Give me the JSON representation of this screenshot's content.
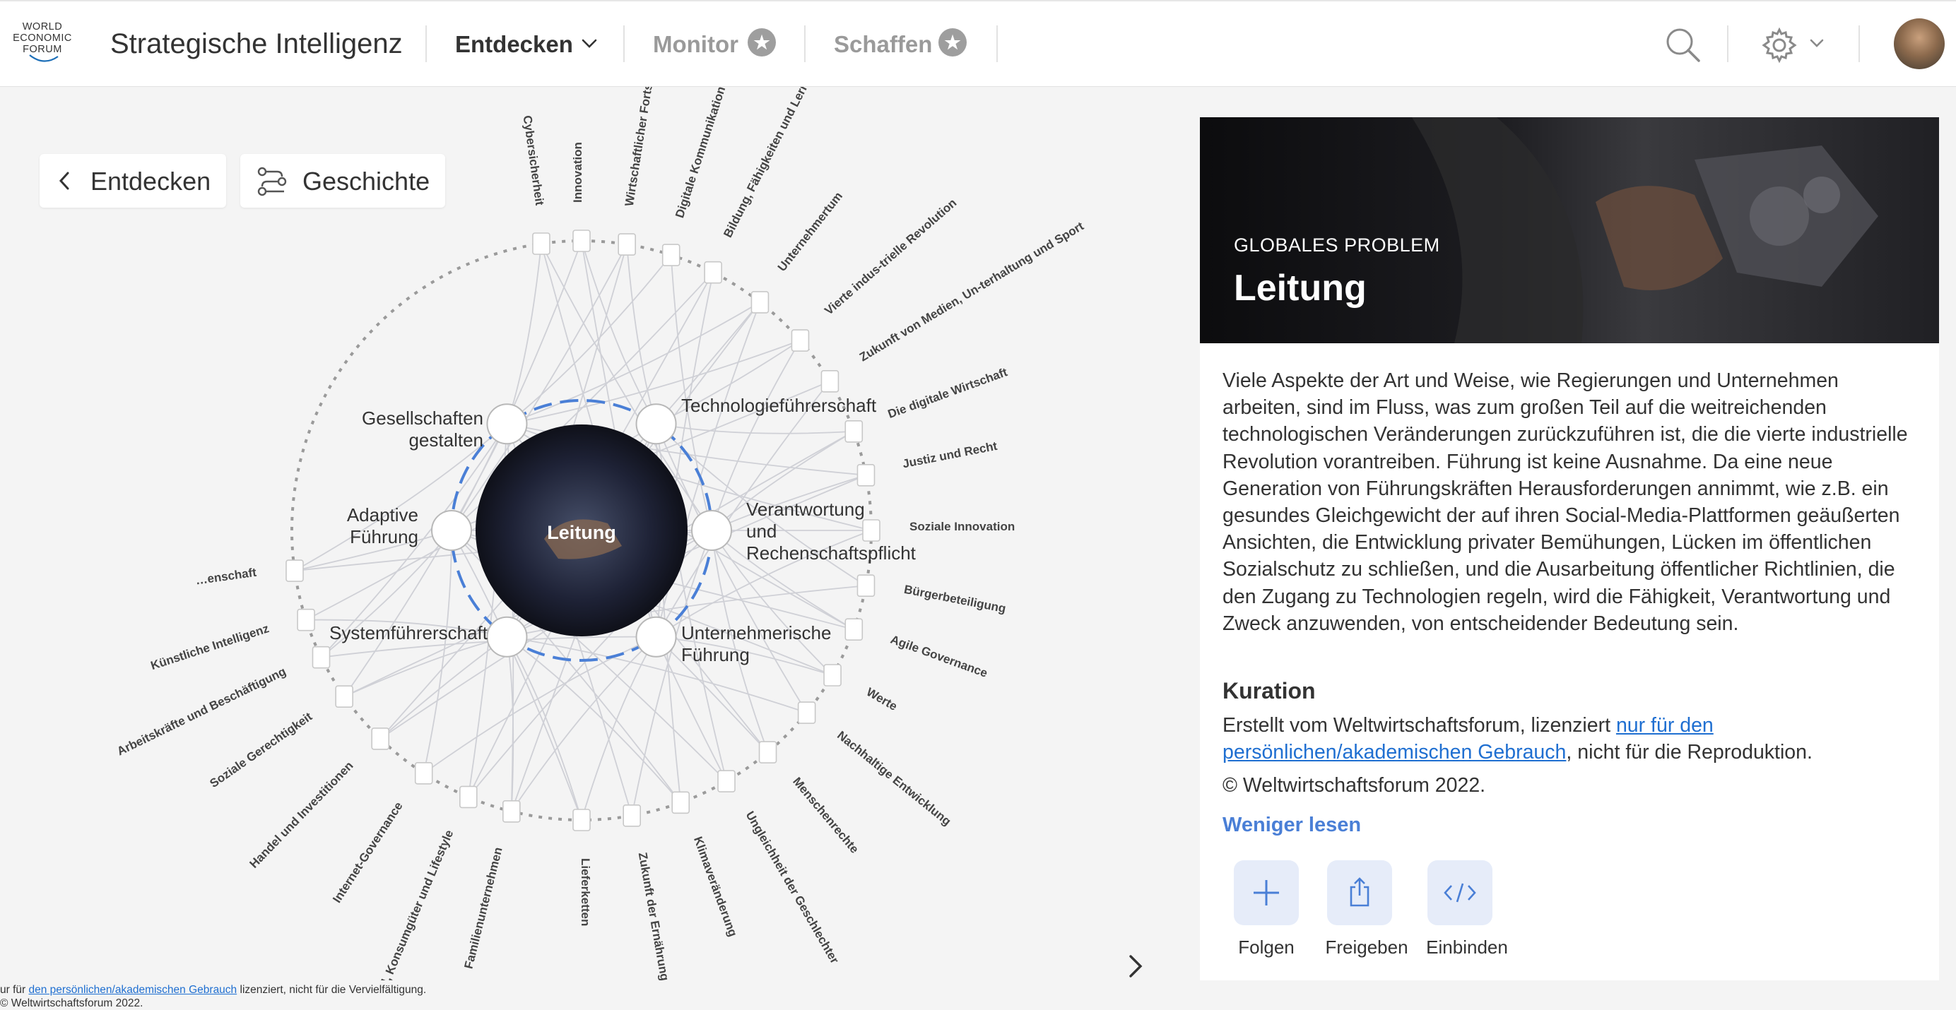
{
  "header": {
    "logo_lines": [
      "WORLD",
      "ECONOMIC",
      "FORUM"
    ],
    "app_title": "Strategische Intelligenz",
    "nav": [
      {
        "label": "Entdecken",
        "active": true,
        "has_dropdown": true
      },
      {
        "label": "Monitor",
        "active": false,
        "icon": "star-icon"
      },
      {
        "label": "Schaffen",
        "active": false,
        "icon": "star-icon"
      }
    ],
    "icons": [
      "search-icon",
      "gear-icon",
      "chevron-down-icon",
      "avatar"
    ]
  },
  "toolbar": {
    "back_label": "Entdecken",
    "story_label": "Geschichte"
  },
  "graph": {
    "center_label": "Leitung",
    "inner_nodes": [
      {
        "label": "Gesellschaften gestalten"
      },
      {
        "label": "Technologieführerschaft"
      },
      {
        "label": "Adaptive Führung"
      },
      {
        "label": "Verantwortung und Rechenschaftspflicht"
      },
      {
        "label": "Systemführerschaft"
      },
      {
        "label": "Unternehmerische Führung"
      }
    ],
    "outer_nodes": [
      {
        "label": "Cybersicherheit"
      },
      {
        "label": "Innovation"
      },
      {
        "label": "Wirtschaftlicher Fortschritt"
      },
      {
        "label": "Digitale Kommunikation"
      },
      {
        "label": "Bildung, Fähigkeiten und Lernen"
      },
      {
        "label": "Unternehmertum"
      },
      {
        "label": "Vierte indus-trielle Revolution"
      },
      {
        "label": "Zukunft von Medien, Un-terhaltung und Sport"
      },
      {
        "label": "Die digitale Wirtschaft"
      },
      {
        "label": "Justiz und Recht"
      },
      {
        "label": "Soziale Innovation"
      },
      {
        "label": "Bürgerbeteiligung"
      },
      {
        "label": "Agile Governance"
      },
      {
        "label": "Werte"
      },
      {
        "label": "Nachhaltige Entwicklung"
      },
      {
        "label": "Menschenrechte"
      },
      {
        "label": "Ungleichheit der Geschlechter"
      },
      {
        "label": "Klimaveränderung"
      },
      {
        "label": "Zukunft der Ernährung"
      },
      {
        "label": "Lieferketten"
      },
      {
        "label": "Familienunternehmen"
      },
      {
        "label": "Einzelhandel, Konsumgüter und Lifestyle"
      },
      {
        "label": "Internet-Governance"
      },
      {
        "label": "Handel und Investitionen"
      },
      {
        "label": "Soziale Gerechtigkeit"
      },
      {
        "label": "Arbeitskräfte und Beschäftigung"
      },
      {
        "label": "Künstliche Intelligenz"
      },
      {
        "label": "…enschaft"
      }
    ]
  },
  "panel": {
    "kicker": "GLOBALES PROBLEM",
    "title": "Leitung",
    "description": "Viele Aspekte der Art und Weise, wie Regierungen und Unternehmen arbeiten, sind im Fluss, was zum großen Teil auf die weitreichenden technologischen Veränderungen zurückzuführen ist, die die vierte industrielle Revolution vorantreiben. Führung ist keine Ausnahme. Da eine neue Generation von Führungskräften Herausforderungen annimmt, wie z.B. ein gesundes Gleichgewicht der auf ihren Social-Media-Plattformen geäußerten Ansichten, die Entwicklung privater Bemühungen, Lücken im öffentlichen Sozialschutz zu schließen, und die Ausarbeitung öffentlicher Richtlinien, die den Zugang zu Technologien regeln, wird die Fähigkeit, Verantwortung und Zweck anzuwenden, von entscheidender Bedeutung sein.",
    "curation_heading": "Kuration",
    "license_prefix": "Erstellt vom Weltwirtschaftsforum, lizenziert ",
    "license_link": "nur für den persönlichen/akademischen Gebrauch",
    "license_suffix": ", nicht für die Reproduktion.",
    "copyright": "© Weltwirtschaftsforum 2022.",
    "read_less": "Weniger lesen",
    "actions": [
      {
        "label": "Folgen",
        "icon": "plus-icon"
      },
      {
        "label": "Freigeben",
        "icon": "share-icon"
      },
      {
        "label": "Einbinden",
        "icon": "embed-code-icon"
      }
    ]
  },
  "footer": {
    "line1_prefix": "ur für ",
    "line1_link": "den persönlichen/akademischen Gebrauch",
    "line1_suffix": " lizenziert, nicht für die Vervielfältigung.",
    "line2": "© Weltwirtschaftsforum 2022."
  },
  "colors": {
    "accent_blue": "#4a7fd6",
    "link_blue": "#1f6fd1",
    "action_bg": "#e6ecf9",
    "background": "#f4f4f4"
  }
}
